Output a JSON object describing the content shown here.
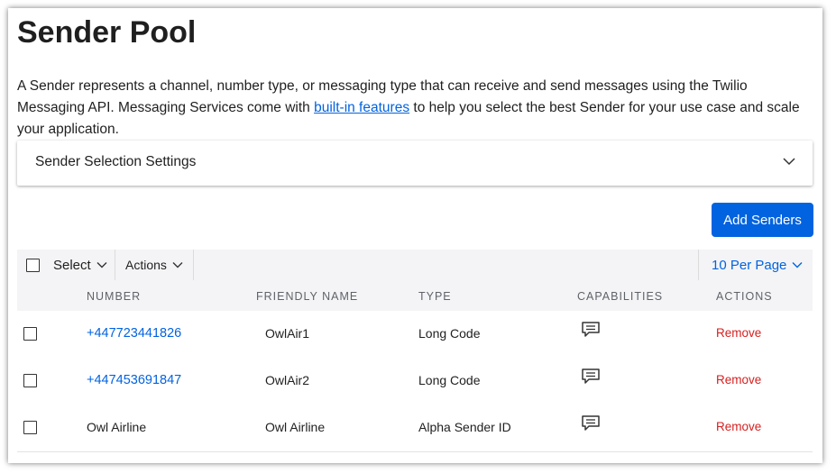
{
  "page": {
    "title": "Sender Pool",
    "description_before": "A Sender represents a channel, number type, or messaging type that can receive and send messages using the Twilio Messaging API. Messaging Services come with ",
    "description_link": "built-in features",
    "description_after": " to help you select the best Sender for your use case and scale your application."
  },
  "settings": {
    "label": "Sender Selection Settings",
    "icon": "chevron-down-icon"
  },
  "actions": {
    "add_senders": "Add Senders"
  },
  "colors": {
    "accent": "#0263e0",
    "danger": "#d61f1f",
    "header_bg": "#f4f4f6"
  },
  "toolbar": {
    "select_label": "Select",
    "actions_label": "Actions",
    "per_page_label": "10 Per Page"
  },
  "table": {
    "columns": [
      "NUMBER",
      "FRIENDLY NAME",
      "TYPE",
      "CAPABILITIES",
      "ACTIONS"
    ],
    "rows": [
      {
        "number": "+447723441826",
        "friendly_name": "OwlAir1",
        "type": "Long Code",
        "capability_icon": "sms-icon",
        "action": "Remove"
      },
      {
        "number": "+447453691847",
        "friendly_name": "OwlAir2",
        "type": "Long Code",
        "capability_icon": "sms-icon",
        "action": "Remove"
      },
      {
        "number": "Owl Airline",
        "friendly_name": "Owl Airline",
        "type": "Alpha Sender ID",
        "capability_icon": "sms-icon",
        "action": "Remove"
      }
    ]
  }
}
